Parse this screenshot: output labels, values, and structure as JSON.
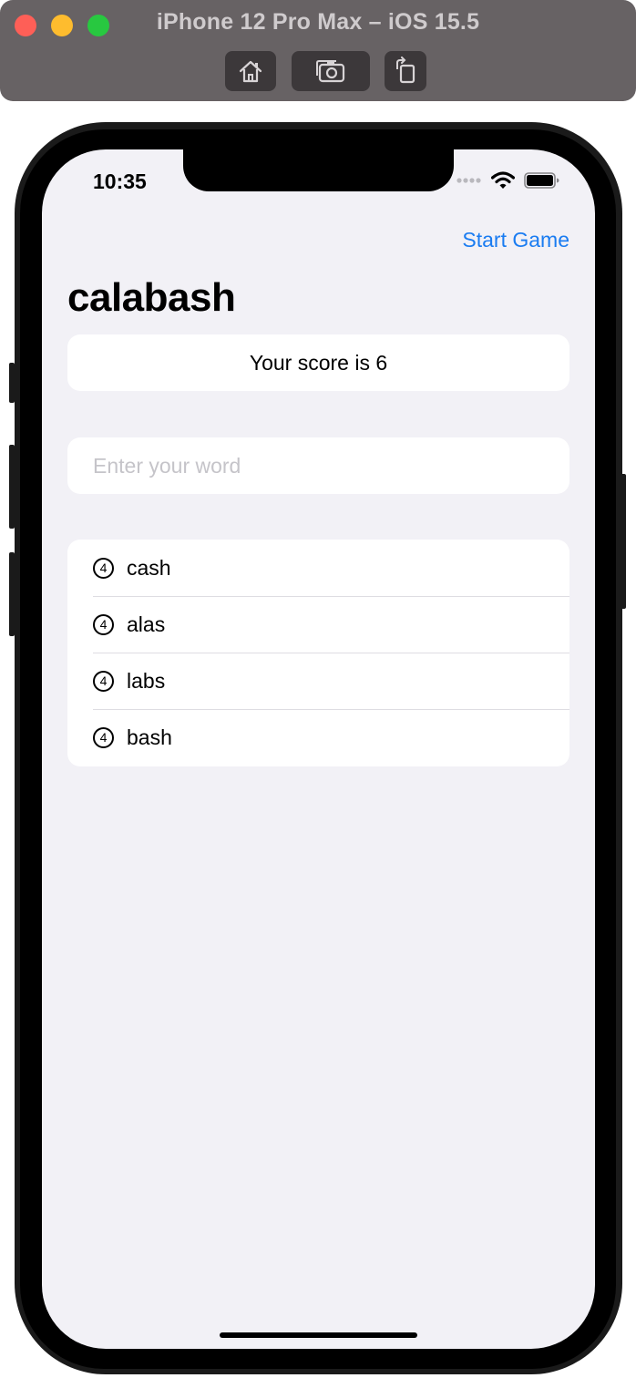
{
  "simulator": {
    "title": "iPhone 12 Pro Max – iOS 15.5",
    "buttons": [
      "home-icon",
      "screenshot-icon",
      "rotate-icon"
    ]
  },
  "status_bar": {
    "time": "10:35",
    "icons": [
      "signal-dots-icon",
      "wifi-icon",
      "battery-icon"
    ]
  },
  "nav": {
    "action_label": "Start Game",
    "title": "calabash",
    "accent_color": "#1a7cf1"
  },
  "score": {
    "text": "Your score is 6"
  },
  "input": {
    "placeholder": "Enter your word",
    "value": ""
  },
  "words": [
    {
      "count": "4",
      "word": "cash"
    },
    {
      "count": "4",
      "word": "alas"
    },
    {
      "count": "4",
      "word": "labs"
    },
    {
      "count": "4",
      "word": "bash"
    }
  ]
}
